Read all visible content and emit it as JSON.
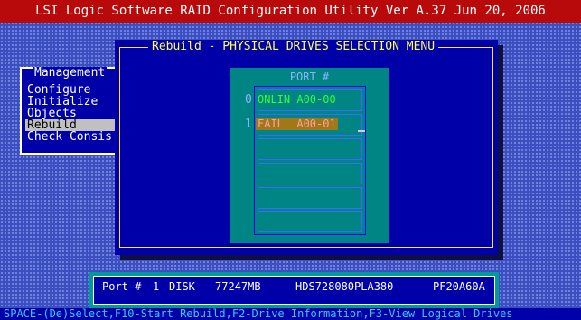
{
  "title": "LSI Logic Software RAID Configuration Utility Ver A.37 Jun 20, 2006",
  "management_menu": {
    "title": "Management",
    "items": [
      "Configure",
      "Initialize",
      "Objects",
      "Rebuild",
      "Check Consis"
    ],
    "selected_index": 3
  },
  "dialog": {
    "title": "Rebuild - PHYSICAL DRIVES SELECTION MENU",
    "column_header": "PORT #",
    "rows": [
      {
        "index": "0",
        "status": "ONLIN",
        "id": "A00-00"
      },
      {
        "index": "1",
        "status": "FAIL",
        "id": "A00-01"
      }
    ],
    "cursor": "_"
  },
  "info_bar": {
    "port_label": "Port #",
    "port_value": "1",
    "disk_label": "DISK",
    "size": "77247MB",
    "model": "HDS728080PLA380",
    "firmware": "PF20A60A"
  },
  "status_bar": "SPACE-(De)Select,F10-Start Rebuild,F2-Drive Information,F3-View Logical Drives",
  "colors": {
    "title_bg": "#b80a0a",
    "screen_bg": "#3b4fc0",
    "dialog_bg": "#0000a8",
    "port_box_bg": "#008484",
    "online": "#33ff33",
    "fail_bg": "#a07818"
  }
}
